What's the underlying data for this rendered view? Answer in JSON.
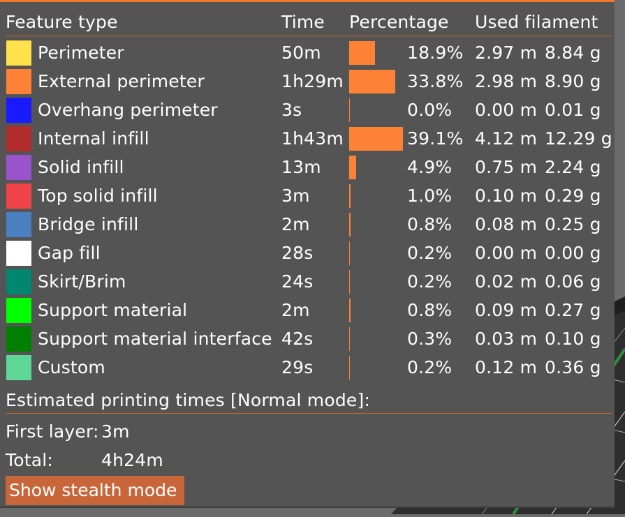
{
  "headers": {
    "feature_type": "Feature type",
    "time": "Time",
    "percentage": "Percentage",
    "used_filament": "Used filament"
  },
  "rows": [
    {
      "name": "Perimeter",
      "color": "#ffe14b",
      "time": "50m",
      "percentage": "18.9%",
      "share": 0.189,
      "length": "2.97 m",
      "weight": "8.84 g"
    },
    {
      "name": "External perimeter",
      "color": "#fd8236",
      "time": "1h29m",
      "percentage": "33.8%",
      "share": 0.338,
      "length": "2.98 m",
      "weight": "8.90 g"
    },
    {
      "name": "Overhang perimeter",
      "color": "#1a1aff",
      "time": "3s",
      "percentage": "0.0%",
      "share": 0.0,
      "length": "0.00 m",
      "weight": "0.01 g"
    },
    {
      "name": "Internal infill",
      "color": "#b12d2d",
      "time": "1h43m",
      "percentage": "39.1%",
      "share": 0.391,
      "length": "4.12 m",
      "weight": "12.29 g"
    },
    {
      "name": "Solid infill",
      "color": "#9954cc",
      "time": "13m",
      "percentage": "4.9%",
      "share": 0.049,
      "length": "0.75 m",
      "weight": "2.24 g"
    },
    {
      "name": "Top solid infill",
      "color": "#f0434a",
      "time": "3m",
      "percentage": "1.0%",
      "share": 0.01,
      "length": "0.10 m",
      "weight": "0.29 g"
    },
    {
      "name": "Bridge infill",
      "color": "#4b80c0",
      "time": "2m",
      "percentage": "0.8%",
      "share": 0.008,
      "length": "0.08 m",
      "weight": "0.25 g"
    },
    {
      "name": "Gap fill",
      "color": "#ffffff",
      "time": "28s",
      "percentage": "0.2%",
      "share": 0.002,
      "length": "0.00 m",
      "weight": "0.00 g"
    },
    {
      "name": "Skirt/Brim",
      "color": "#00876f",
      "time": "24s",
      "percentage": "0.2%",
      "share": 0.002,
      "length": "0.02 m",
      "weight": "0.06 g"
    },
    {
      "name": "Support material",
      "color": "#00ff00",
      "time": "2m",
      "percentage": "0.8%",
      "share": 0.008,
      "length": "0.09 m",
      "weight": "0.27 g"
    },
    {
      "name": "Support material interface",
      "color": "#008000",
      "time": "42s",
      "percentage": "0.3%",
      "share": 0.003,
      "length": "0.03 m",
      "weight": "0.10 g"
    },
    {
      "name": "Custom",
      "color": "#5ed796",
      "time": "29s",
      "percentage": "0.2%",
      "share": 0.002,
      "length": "0.12 m",
      "weight": "0.36 g"
    }
  ],
  "estimated_label": "Estimated printing times [Normal mode]:",
  "first_layer_label": "First layer:",
  "first_layer_value": "3m",
  "total_label": "Total:",
  "total_value": "4h24m",
  "stealth_button_label": "Show stealth mode",
  "colors": {
    "accent": "#f07a2a",
    "bar": "#fd8236",
    "panel": "#545454",
    "button": "#c8663a"
  }
}
